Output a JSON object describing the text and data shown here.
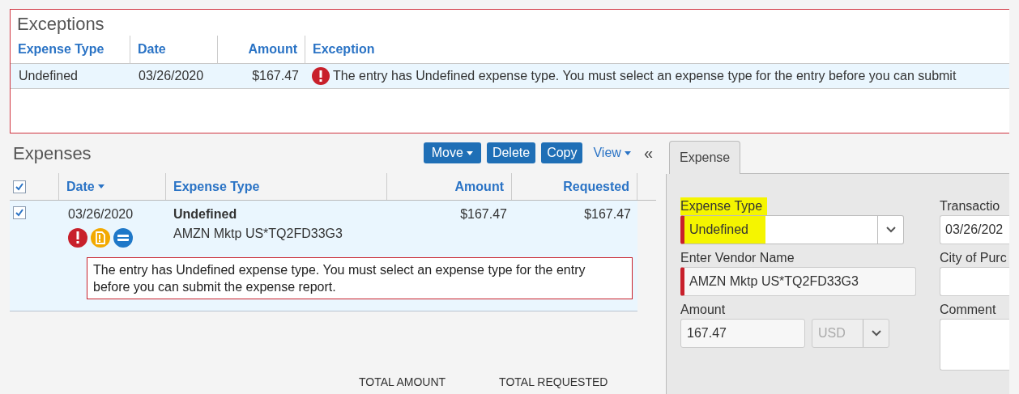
{
  "exceptions": {
    "title": "Exceptions",
    "columns": [
      "Expense Type",
      "Date",
      "Amount",
      "Exception"
    ],
    "rows": [
      {
        "expense_type": "Undefined",
        "date": "03/26/2020",
        "amount": "$167.47",
        "exception": "The entry has Undefined expense type. You must select an expense type for the entry before you can submit",
        "selected": true
      }
    ]
  },
  "expenses": {
    "title": "Expenses",
    "toolbar": [
      {
        "label": "Move",
        "kind": "menu-button"
      },
      {
        "label": "Delete",
        "kind": "button"
      },
      {
        "label": "Copy",
        "kind": "button"
      },
      {
        "label": "View",
        "kind": "menu-link"
      }
    ],
    "collapse": "«",
    "select_all": {
      "checked": true
    },
    "columns": [
      {
        "label": "Date",
        "sorted": true
      },
      {
        "label": "Expense Type",
        "sorted": false
      },
      {
        "label": "Amount",
        "sorted": false
      },
      {
        "label": "Requested",
        "sorted": false
      }
    ],
    "rows": [
      {
        "checked": true,
        "selected": true,
        "date": "03/26/2020",
        "expense_type": "Undefined",
        "vendor": "AMZN Mktp US*TQ2FD33G3",
        "amount": "$167.47",
        "requested": "$167.47",
        "message": "The entry has Undefined expense type. You must select an expense type for the entry before you can submit the expense report."
      }
    ],
    "totals": [
      "TOTAL AMOUNT",
      "TOTAL REQUESTED"
    ]
  },
  "detail": {
    "tabs": [
      {
        "label": "Expense",
        "selected": true
      }
    ],
    "left_fields": [
      {
        "kind": "select",
        "label": "Expense Type",
        "value": "Undefined",
        "required": true,
        "highlighted": true
      },
      {
        "kind": "text",
        "label": "Enter Vendor Name",
        "value": "AMZN Mktp US*TQ2FD33G3",
        "required": true,
        "highlighted": false
      },
      {
        "kind": "amount",
        "label": "Amount",
        "value": "167.47",
        "currency": "USD",
        "required": false,
        "highlighted": false
      }
    ],
    "right_fields": [
      {
        "kind": "cut",
        "label": "Transactio",
        "value": "03/26/202"
      },
      {
        "kind": "cut",
        "label": "City of Purc"
      },
      {
        "kind": "textarea",
        "label": "Comment"
      }
    ]
  }
}
